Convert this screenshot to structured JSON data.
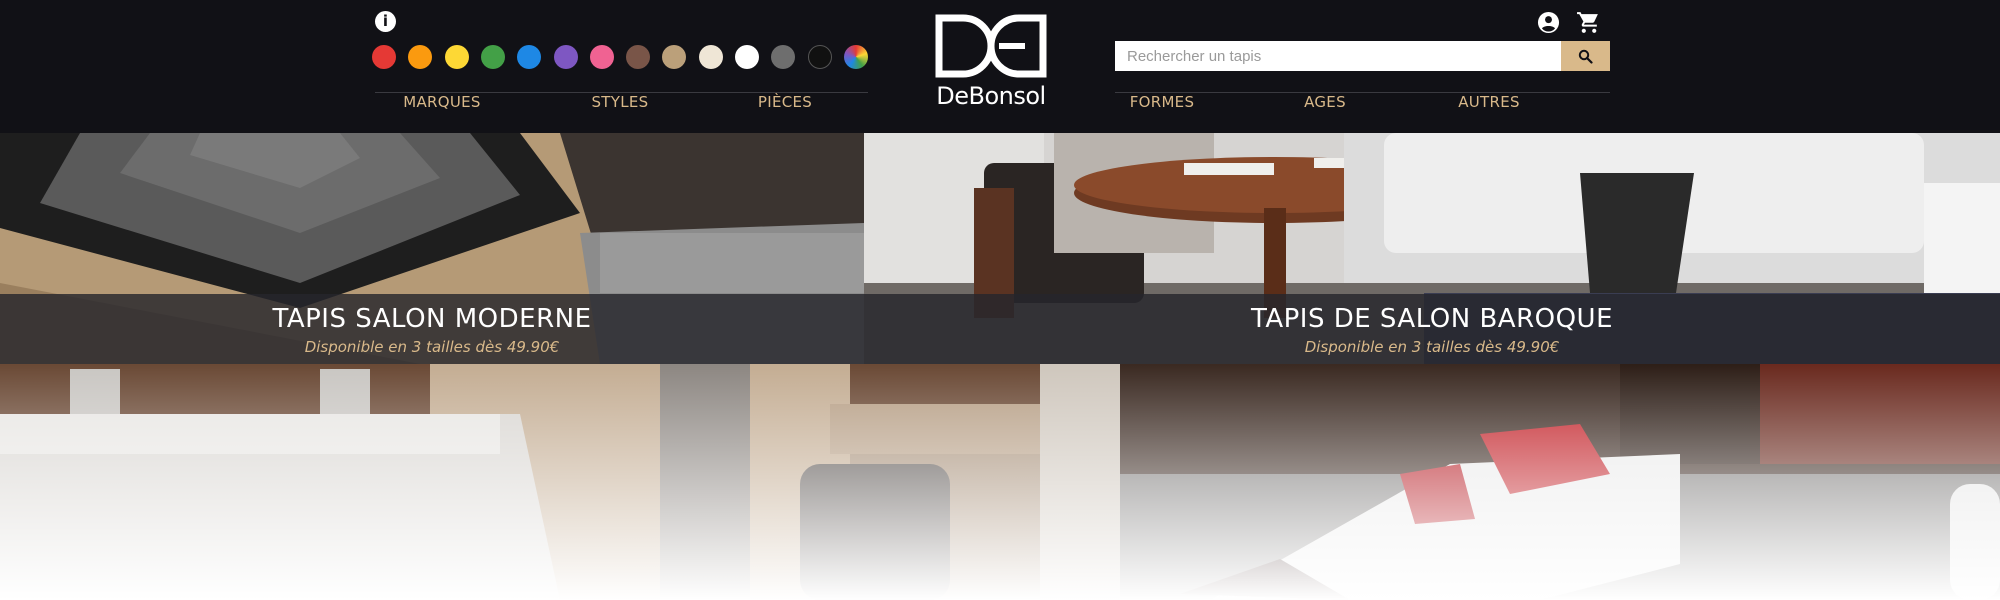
{
  "header": {
    "color_swatches": [
      {
        "name": "rouge",
        "color": "#e53935"
      },
      {
        "name": "orange",
        "color": "#fb9a0f"
      },
      {
        "name": "jaune",
        "color": "#fdd835"
      },
      {
        "name": "vert",
        "color": "#43a047"
      },
      {
        "name": "bleu",
        "color": "#1e88e5"
      },
      {
        "name": "violet",
        "color": "#7e57c2"
      },
      {
        "name": "rose",
        "color": "#f06292"
      },
      {
        "name": "marron",
        "color": "#795548"
      },
      {
        "name": "beige",
        "color": "#bba07a"
      },
      {
        "name": "creme",
        "color": "#efe6d6"
      },
      {
        "name": "blanc",
        "color": "#ffffff"
      },
      {
        "name": "gris",
        "color": "#6e6e6e"
      },
      {
        "name": "noir",
        "color": "#111111"
      },
      {
        "name": "multicolore",
        "color": "multi"
      }
    ],
    "nav_left": [
      "MARQUES",
      "STYLES",
      "PIÈCES"
    ],
    "nav_right": [
      "FORMES",
      "AGES",
      "AUTRES"
    ],
    "logo_text": "DeBonsol",
    "search": {
      "placeholder": "Rechercher un tapis"
    },
    "icons": [
      "info-icon",
      "account-icon",
      "cart-icon",
      "search-icon"
    ],
    "colors": {
      "background": "#111116",
      "accent": "#d9b98a"
    }
  },
  "banners": [
    {
      "title": "TAPIS SALON MODERNE",
      "subtitle": "Disponible en 3 tailles dès 49.90€"
    },
    {
      "title": "TAPIS DE SALON BAROQUE",
      "subtitle": "Disponible en 3 tailles dès 49.90€"
    }
  ]
}
